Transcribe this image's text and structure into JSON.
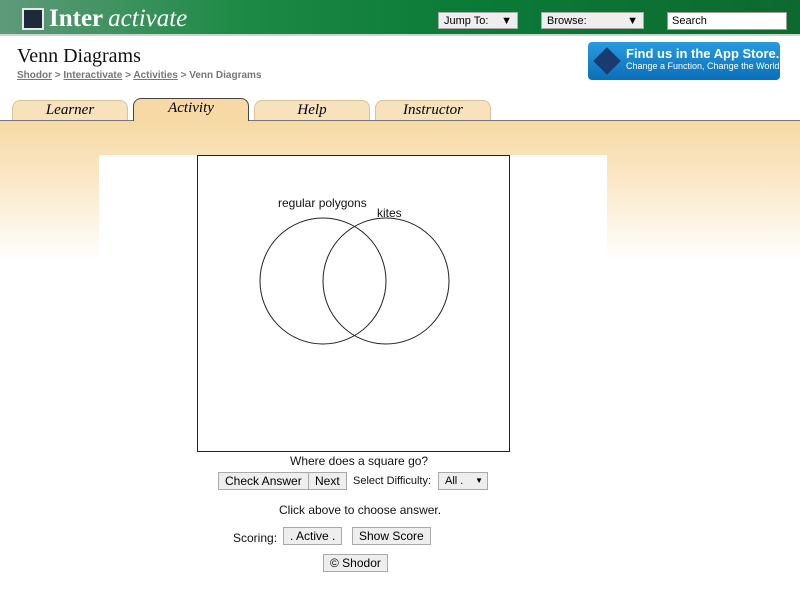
{
  "header": {
    "logo_main": "Inter",
    "logo_italic": "activate",
    "jump_to": "Jump To:",
    "browse": "Browse:",
    "search_placeholder": "Search"
  },
  "page": {
    "title": "Venn Diagrams",
    "breadcrumb": [
      "Shodor",
      "Interactivate",
      "Activities",
      "Venn Diagrams"
    ],
    "separator": ">"
  },
  "app_store": {
    "line1": "Find us in the App Store.",
    "line2": "Change a Function, Change the World"
  },
  "tabs": [
    {
      "label": "Learner"
    },
    {
      "label": "Activity",
      "active": true
    },
    {
      "label": "Help"
    },
    {
      "label": "Instructor"
    }
  ],
  "venn": {
    "left_label": "regular polygons",
    "right_label": "kites"
  },
  "controls": {
    "question": "Where does a square go?",
    "check": "Check Answer",
    "next": "Next",
    "difficulty_label": "Select Difficulty:",
    "difficulty_value": "All .",
    "hint": "Click above to choose answer.",
    "scoring_label": "Scoring:",
    "active": ". Active .",
    "show_score": "Show Score",
    "copyright": "© Shodor"
  }
}
